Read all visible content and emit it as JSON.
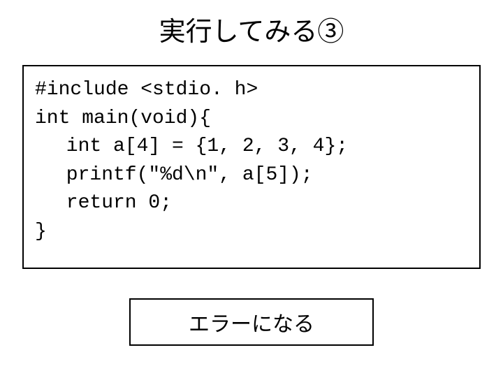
{
  "title": "実行してみる③",
  "code": {
    "line1": "#include <stdio. h>",
    "line2": "int main(void){",
    "line3": "int a[4] = {1, 2, 3, 4};",
    "line4": "printf(\"%d\\n\", a[5]);",
    "line5": "return 0;",
    "line6": "}"
  },
  "result": "エラーになる"
}
